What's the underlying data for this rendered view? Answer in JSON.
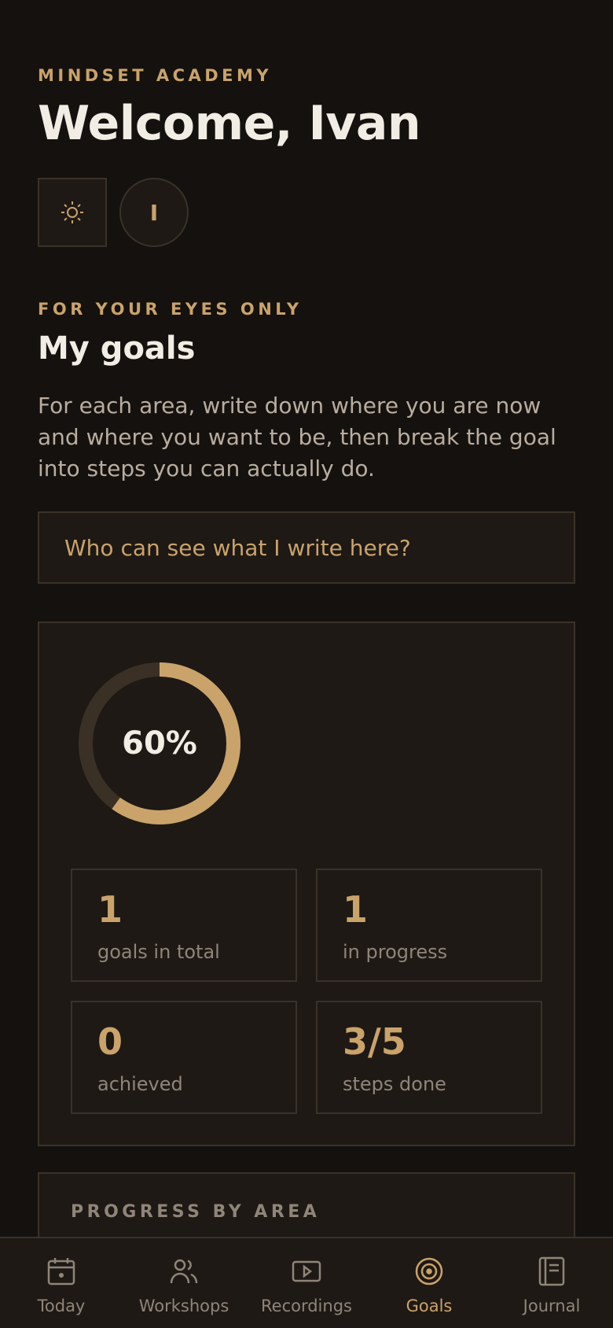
{
  "header": {
    "brand": "MINDSET ACADEMY",
    "welcome": "Welcome, Ivan",
    "avatar_initial": "I",
    "theme_icon": "sun-icon"
  },
  "goals": {
    "eyebrow": "FOR YOUR EYES ONLY",
    "title": "My goals",
    "intro": "For each area, write down where you are now and where you want to be, then break the goal into steps you can actually do.",
    "privacy_question": "Who can see what I write here?"
  },
  "summary": {
    "progress_percent": 60,
    "progress_label": "60%",
    "stats": [
      {
        "value": "1",
        "label": "goals in total"
      },
      {
        "value": "1",
        "label": "in progress"
      },
      {
        "value": "0",
        "label": "achieved"
      },
      {
        "value": "3/5",
        "label": "steps done"
      }
    ]
  },
  "areas": {
    "title": "PROGRESS BY AREA"
  },
  "nav": {
    "tabs": [
      {
        "label": "Today",
        "icon": "calendar-icon",
        "active": false
      },
      {
        "label": "Workshops",
        "icon": "people-icon",
        "active": false
      },
      {
        "label": "Recordings",
        "icon": "play-icon",
        "active": false
      },
      {
        "label": "Goals",
        "icon": "target-icon",
        "active": true
      },
      {
        "label": "Journal",
        "icon": "journal-icon",
        "active": false
      }
    ]
  },
  "colors": {
    "background": "#15110e",
    "surface": "#1e1915",
    "accent": "#c9a36a",
    "ring_track": "#3b3025"
  }
}
